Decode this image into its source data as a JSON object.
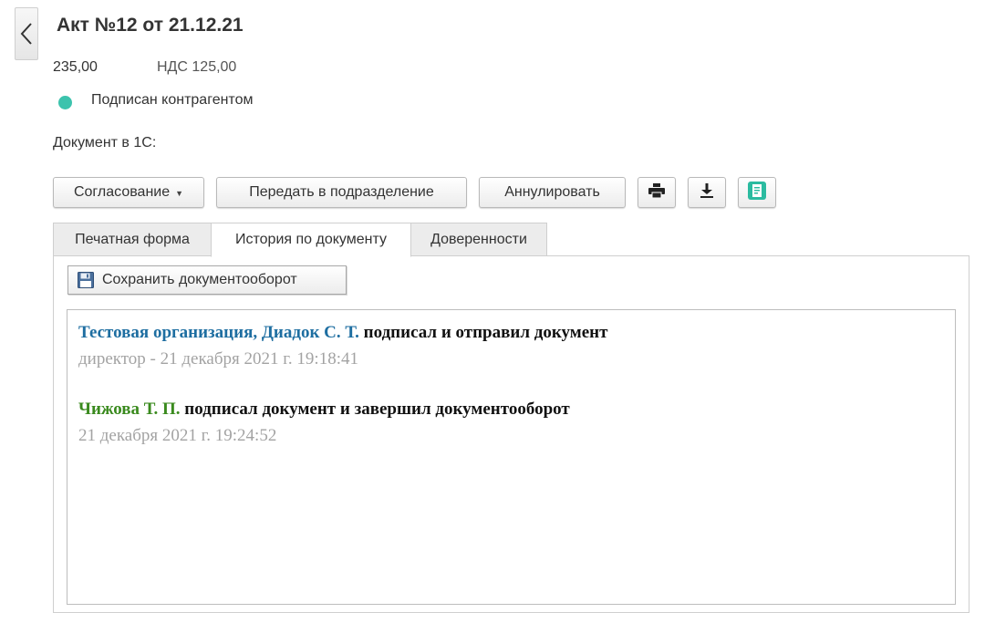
{
  "header": {
    "title": "Акт №12 от 21.12.21",
    "amount": "235,00",
    "vat": "НДС 125,00",
    "status": "Подписан контрагентом",
    "status_color": "#3cc3ad",
    "document_in_1c_label": "Документ в 1С:"
  },
  "toolbar": {
    "approval_label": "Согласование",
    "transfer_label": "Передать в подразделение",
    "annul_label": "Аннулировать",
    "icons": [
      "printer-icon",
      "download-icon",
      "edo-document-icon"
    ]
  },
  "tabs": [
    {
      "label": "Печатная форма",
      "active": false
    },
    {
      "label": "История по документу",
      "active": true
    },
    {
      "label": "Доверенности",
      "active": false
    }
  ],
  "history": {
    "save_button_label": "Сохранить документооборот",
    "entries": [
      {
        "actor": "Тестовая организация, Диадок С. Т.",
        "actor_color": "#1e6ea1",
        "action": "подписал и отправил документ",
        "meta": "директор - 21 декабря 2021 г. 19:18:41"
      },
      {
        "actor": "Чижова Т. П.",
        "actor_color": "#3a8a1e",
        "action": "подписал документ и завершил документооборот",
        "meta": "21 декабря 2021 г. 19:24:52"
      }
    ]
  }
}
